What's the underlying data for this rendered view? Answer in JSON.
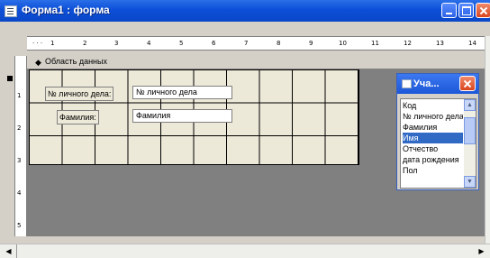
{
  "window": {
    "title": "Форма1 : форма"
  },
  "ruler": {
    "marks": [
      "1",
      "2",
      "3",
      "4",
      "5",
      "6",
      "7",
      "8",
      "9",
      "10",
      "11",
      "12",
      "13",
      "14"
    ]
  },
  "vruler": {
    "marks": [
      "1",
      "2",
      "3",
      "4",
      "5"
    ]
  },
  "section": {
    "label": "Область данных"
  },
  "controls": [
    {
      "label": "№ личного дела:",
      "field": "№ личного дела"
    },
    {
      "label": "Фамилия:",
      "field": "Фамилия"
    }
  ],
  "field_list": {
    "title": "Уча...",
    "items": [
      "Код",
      "№ личного дела",
      "Фамилия",
      "Имя",
      "Отчество",
      "дата рождения",
      "Пол"
    ],
    "selected_index": 3
  }
}
